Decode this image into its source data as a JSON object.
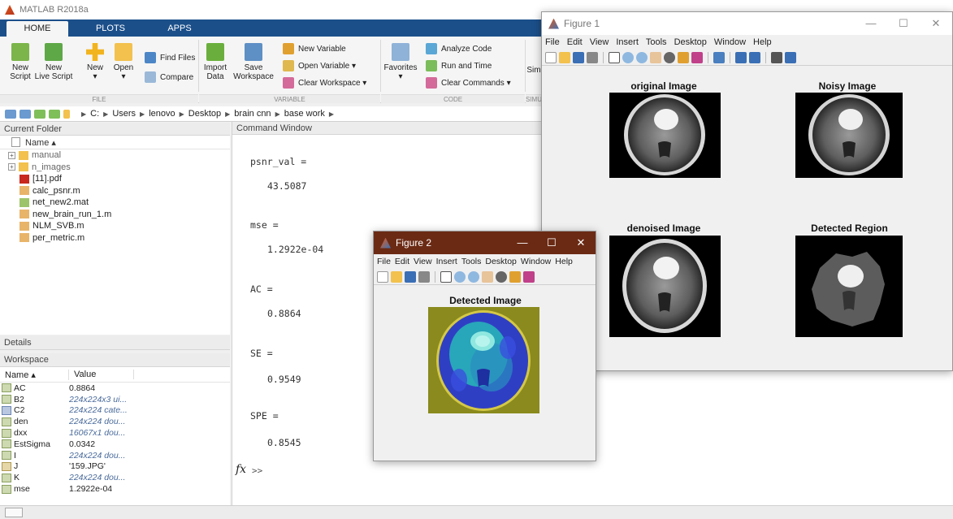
{
  "app": {
    "title": "MATLAB R2018a",
    "tabs": [
      "HOME",
      "PLOTS",
      "APPS"
    ]
  },
  "ribbon": {
    "new_script": "New\nScript",
    "new_live_script": "New\nLive Script",
    "new": "New",
    "open": "Open",
    "find_files": "Find Files",
    "compare": "Compare",
    "import_data": "Import\nData",
    "save_workspace": "Save\nWorkspace",
    "new_variable": "New Variable",
    "open_variable": "Open Variable ▾",
    "clear_workspace": "Clear Workspace ▾",
    "favorites": "Favorites",
    "analyze_code": "Analyze Code",
    "run_and_time": "Run and Time",
    "clear_commands": "Clear Commands ▾",
    "sim_partial": "Sim",
    "section_file": "FILE",
    "section_variable": "VARIABLE",
    "section_code": "CODE",
    "section_sim_partial": "SIMU"
  },
  "path": {
    "segments": [
      "C:",
      "Users",
      "lenovo",
      "Desktop",
      "brain cnn",
      "base work"
    ]
  },
  "current_folder": {
    "title": "Current Folder",
    "column_name": "Name ▴",
    "items": [
      {
        "name": "manual",
        "type": "folder"
      },
      {
        "name": "n_images",
        "type": "folder"
      },
      {
        "name": "[11].pdf",
        "type": "pdf"
      },
      {
        "name": "calc_psnr.m",
        "type": "m"
      },
      {
        "name": "net_new2.mat",
        "type": "mat"
      },
      {
        "name": "new_brain_run_1.m",
        "type": "m"
      },
      {
        "name": "NLM_SVB.m",
        "type": "m"
      },
      {
        "name": "per_metric.m",
        "type": "m"
      }
    ]
  },
  "details": {
    "title": "Details"
  },
  "workspace": {
    "title": "Workspace",
    "col_name": "Name ▴",
    "col_value": "Value",
    "rows": [
      {
        "name": "AC",
        "value": "0.8864",
        "italic": false
      },
      {
        "name": "B2",
        "value": "224x224x3 ui...",
        "italic": true
      },
      {
        "name": "C2",
        "value": "224x224 cate...",
        "italic": true
      },
      {
        "name": "den",
        "value": "224x224 dou...",
        "italic": true
      },
      {
        "name": "dxx",
        "value": "16067x1 dou...",
        "italic": true
      },
      {
        "name": "EstSigma",
        "value": "0.0342",
        "italic": false
      },
      {
        "name": "I",
        "value": "224x224 dou...",
        "italic": true
      },
      {
        "name": "J",
        "value": "'159.JPG'",
        "italic": false
      },
      {
        "name": "K",
        "value": "224x224 dou...",
        "italic": true
      },
      {
        "name": "mse",
        "value": "1.2922e-04",
        "italic": false
      }
    ]
  },
  "command_window": {
    "title": "Command Window",
    "lines": [
      {
        "label": "psnr_val =",
        "value": "43.5087"
      },
      {
        "label": "mse =",
        "value": "1.2922e-04"
      },
      {
        "label": "AC =",
        "value": "0.8864"
      },
      {
        "label": "SE =",
        "value": "0.9549"
      },
      {
        "label": "SPE =",
        "value": "0.8545"
      }
    ],
    "fx": "fx",
    "prompt": ">>"
  },
  "figure1": {
    "title": "Figure 1",
    "menu": [
      "File",
      "Edit",
      "View",
      "Insert",
      "Tools",
      "Desktop",
      "Window",
      "Help"
    ],
    "subplots": [
      "original Image",
      "Noisy Image",
      "denoised Image",
      "Detected Region"
    ]
  },
  "figure2": {
    "title": "Figure 2",
    "menu": [
      "File",
      "Edit",
      "View",
      "Insert",
      "Tools",
      "Desktop",
      "Window",
      "Help"
    ],
    "subplot": "Detected Image"
  },
  "colors": {
    "tab_blue": "#1b4f8a",
    "fig2_titlebar": "#6b2a14",
    "olive": "#8a8a1e",
    "cluster_blue": "#2f3fc4",
    "cluster_cyan": "#27b8b8"
  }
}
